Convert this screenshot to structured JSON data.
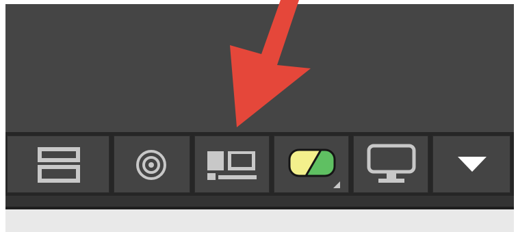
{
  "toolbar": {
    "buttons": [
      {
        "icon": "split-horizontal-icon"
      },
      {
        "icon": "concentric-circle-icon"
      },
      {
        "icon": "layout-panels-icon"
      },
      {
        "icon": "color-swatch-icon"
      },
      {
        "icon": "monitor-icon"
      },
      {
        "icon": "dropdown-arrow-icon"
      }
    ]
  },
  "annotation": {
    "arrow_color": "#e5473a"
  },
  "colors": {
    "panel": "#454545",
    "button": "#444444",
    "icon": "#c8c8c8",
    "swatch_yellow": "#f3f08c",
    "swatch_green": "#5fc062"
  }
}
